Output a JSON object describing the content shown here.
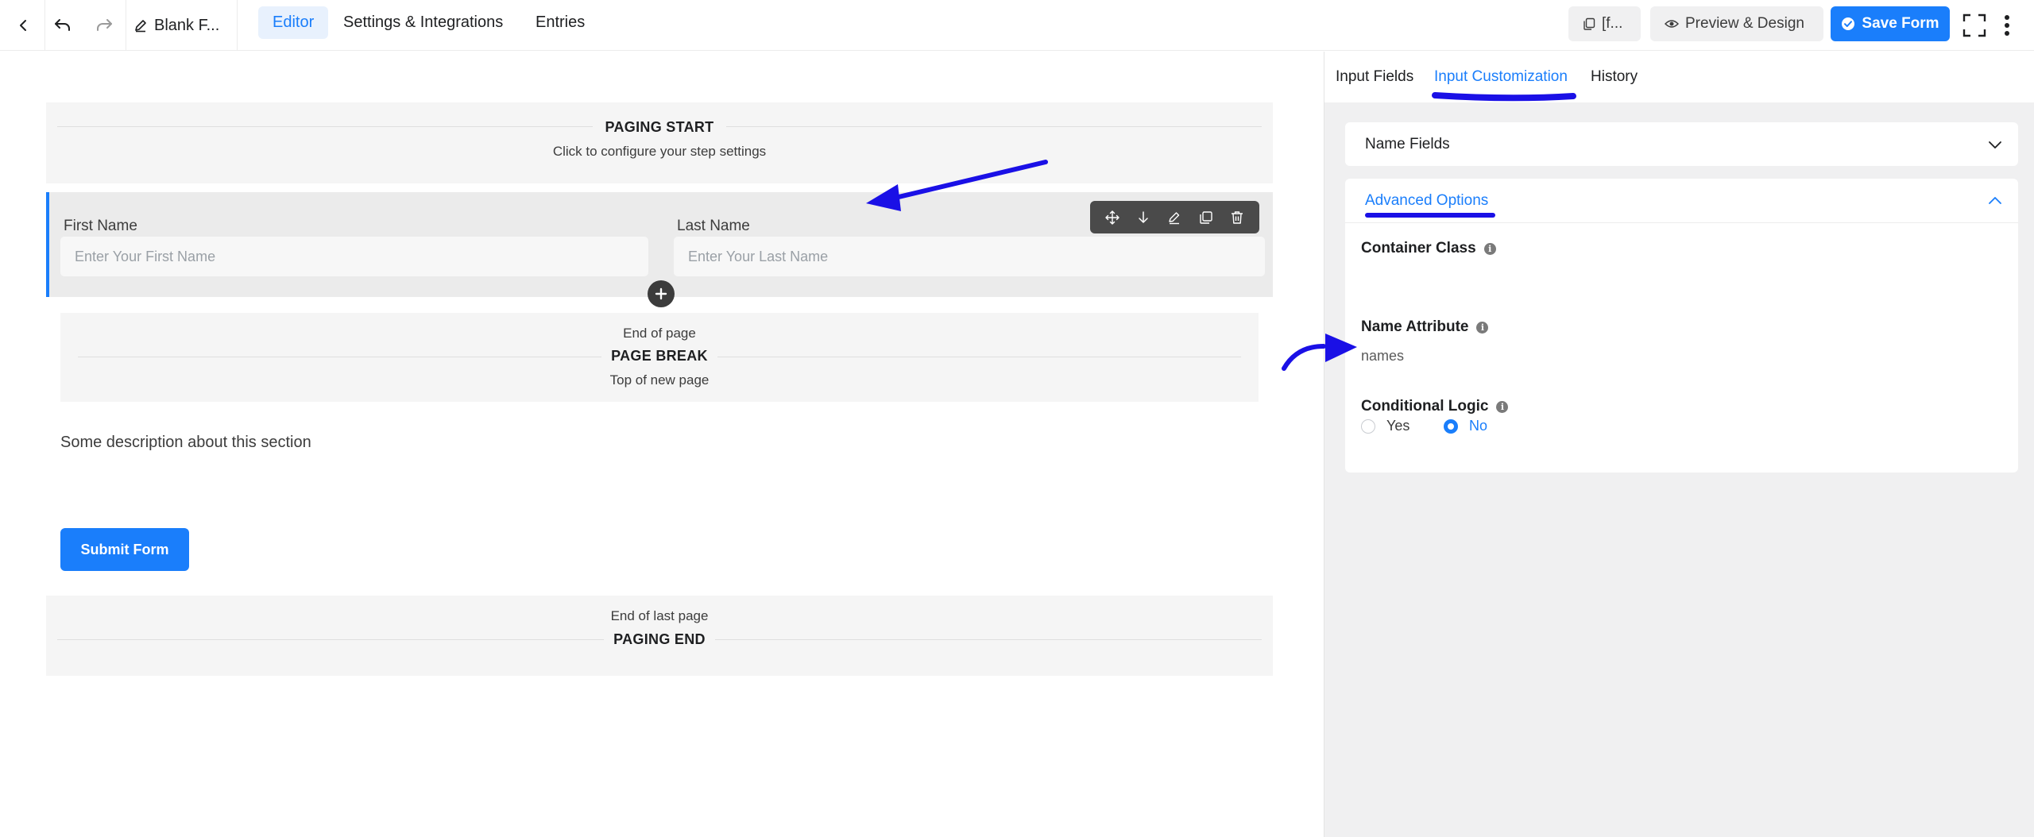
{
  "header": {
    "form_title": "Blank F...",
    "tabs": [
      "Editor",
      "Settings & Integrations",
      "Entries"
    ],
    "shortcode_label": "[f...",
    "preview_label": "Preview & Design",
    "save_label": "Save Form"
  },
  "canvas": {
    "paging_start": {
      "title": "PAGING START",
      "subtitle": "Click to configure your step settings"
    },
    "name_fields": {
      "first_label": "First Name",
      "first_placeholder": "Enter Your First Name",
      "last_label": "Last Name",
      "last_placeholder": "Enter Your Last Name"
    },
    "page_break": {
      "top": "End of page",
      "title": "PAGE BREAK",
      "bottom": "Top of new page"
    },
    "description": "Some description about this section",
    "submit_label": "Submit Form",
    "paging_end": {
      "top": "End of last page",
      "title": "PAGING END"
    }
  },
  "sidebar": {
    "tabs": [
      "Input Fields",
      "Input Customization",
      "History"
    ],
    "active_tab": "Input Customization",
    "name_fields_label": "Name Fields",
    "advanced_options_label": "Advanced Options",
    "container_class_label": "Container Class",
    "container_class_value": "",
    "name_attribute_label": "Name Attribute",
    "name_attribute_value": "names",
    "conditional_logic_label": "Conditional Logic",
    "conditional_logic_options": [
      "Yes",
      "No"
    ],
    "conditional_logic_selected": "No"
  },
  "colors": {
    "accent": "#1a7efb",
    "annotation": "#1a10e6",
    "panel_bg": "#f0f0f1"
  }
}
